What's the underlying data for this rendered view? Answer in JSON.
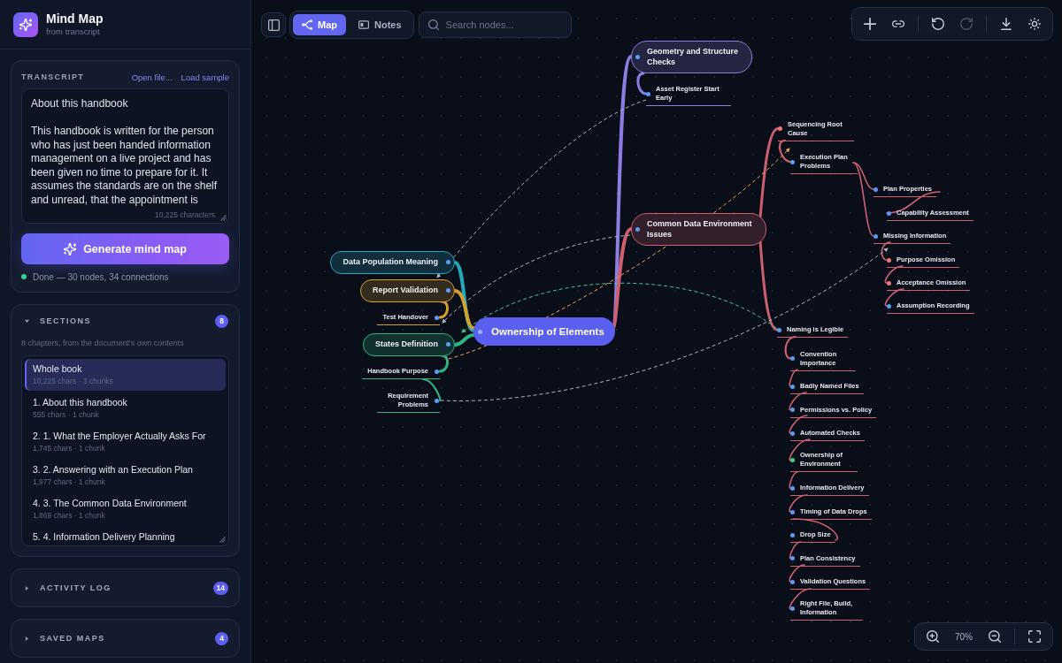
{
  "app": {
    "title": "Mind Map",
    "subtitle": "from transcript"
  },
  "transcript": {
    "label": "TRANSCRIPT",
    "links": [
      {
        "label": "Open file..."
      },
      {
        "label": "Load sample"
      }
    ],
    "value": "About this handbook\n\nThis handbook is written for the person who has just been handed information management on a live project and has been given no time to prepare for it. It assumes the standards are on the shelf and unread, that the appointment is",
    "char_count": "10,225 characters",
    "generate_button": "Generate mind map",
    "status": {
      "text": "Done — 30 nodes, 34 connections",
      "kind": "done"
    }
  },
  "sections": {
    "title": "SECTIONS",
    "count": "8",
    "expanded": true,
    "description": "8 chapters, from the document's own contents",
    "items": [
      {
        "title": "Whole book",
        "meta": "10,225 chars · 3 chunks",
        "selected": true
      },
      {
        "title": "1. About this handbook",
        "meta": "555 chars · 1 chunk",
        "selected": false
      },
      {
        "title": "2. 1. What the Employer Actually Asks For",
        "meta": "1,745 chars · 1 chunk",
        "selected": false
      },
      {
        "title": "3. 2. Answering with an Execution Plan",
        "meta": "1,977 chars · 1 chunk",
        "selected": false
      },
      {
        "title": "4. 3. The Common Data Environment",
        "meta": "1,869 chars · 1 chunk",
        "selected": false
      },
      {
        "title": "5. 4. Information Delivery Planning",
        "selected": false
      }
    ]
  },
  "panels": [
    {
      "title": "ACTIVITY LOG",
      "count": "14",
      "expanded": false
    },
    {
      "title": "SAVED MAPS",
      "count": "4",
      "expanded": false
    }
  ],
  "view_tabs": [
    {
      "label": "Map",
      "kind": "map",
      "selected": true
    },
    {
      "label": "Notes",
      "kind": "notes",
      "selected": false
    }
  ],
  "search": {
    "placeholder": "Search nodes..."
  },
  "actions": [
    [
      {
        "kind": "add",
        "disabled": false
      },
      {
        "kind": "link",
        "disabled": false
      }
    ],
    [
      {
        "kind": "undo",
        "disabled": false
      },
      {
        "kind": "redo",
        "disabled": true
      }
    ],
    [
      {
        "kind": "download",
        "disabled": false
      },
      {
        "kind": "theme",
        "disabled": false
      }
    ]
  ],
  "zoom": {
    "reading": "70%"
  },
  "mind_map": {
    "root": {
      "text": "Ownership of Elements",
      "kind": "root",
      "color": "#8fb0ff",
      "children": [
        {
          "text": "Data Population Meaning",
          "kind": "topic",
          "branch": {
            "color": "#22a9c0"
          },
          "color": "#5b9cf5"
        },
        {
          "text": "Report Validation",
          "kind": "topic",
          "branch": {
            "color": "#d4a22c"
          },
          "color": "#5b9cf5",
          "children": [
            {
              "text": "Test Handover",
              "kind": "subtopic",
              "color": "#5b9cf5"
            }
          ]
        },
        {
          "text": "States Definition",
          "kind": "topic",
          "branch": {
            "color": "#2fb384"
          },
          "color": "#5b9cf5",
          "children": [
            {
              "text": "Handbook Purpose",
              "kind": "subtopic",
              "color": "#5b9cf5",
              "children": [
                {
                  "text": "Requirement Problems",
                  "kind": "subtopic",
                  "color": "#5b9cf5"
                }
              ]
            }
          ]
        },
        {
          "text": "Geometry and Structure Checks",
          "kind": "topic",
          "branch": {
            "color": "#8b7ee0"
          },
          "color": "#5b9cf5",
          "children": [
            {
              "text": "Asset Register Start Early",
              "kind": "subtopic",
              "color": "#5b9cf5"
            }
          ]
        },
        {
          "text": "Common Data Environment Issues",
          "kind": "topic",
          "branch": {
            "color": "#cc5f70"
          },
          "color": "#5b9cf5",
          "children": [
            {
              "text": "Sequencing Root Cause",
              "kind": "subtopic",
              "color": "#f07575",
              "children": [
                {
                  "text": "Execution Plan Problems",
                  "kind": "subtopic",
                  "color": "#5b9cf5",
                  "children": [
                    {
                      "text": "Plan Properties",
                      "kind": "subtopic",
                      "color": "#5b9cf5",
                      "children": [
                        {
                          "text": "Capability Assessment",
                          "kind": "subtopic",
                          "color": "#5b9cf5"
                        }
                      ]
                    },
                    {
                      "text": "Missing Information",
                      "kind": "subtopic",
                      "color": "#5b9cf5",
                      "children": [
                        {
                          "text": "Purpose Omission",
                          "kind": "subtopic",
                          "color": "#f07575",
                          "children": [
                            {
                              "text": "Acceptance Omission",
                              "kind": "subtopic",
                              "color": "#f07575",
                              "children": [
                                {
                                  "text": "Assumption Recording",
                                  "kind": "subtopic",
                                  "color": "#5b9cf5"
                                }
                              ]
                            }
                          ]
                        }
                      ]
                    }
                  ]
                }
              ]
            },
            {
              "text": "Naming is Legible",
              "kind": "subtopic",
              "color": "#5b9cf5",
              "children": [
                {
                  "text": "Convention Importance",
                  "kind": "subtopic",
                  "color": "#5b9cf5",
                  "children": [
                    {
                      "text": "Badly Named Files",
                      "kind": "subtopic",
                      "color": "#5b9cf5",
                      "children": [
                        {
                          "text": "Permissions vs. Policy",
                          "kind": "subtopic",
                          "color": "#5b9cf5",
                          "children": [
                            {
                              "text": "Automated Checks",
                              "kind": "subtopic",
                              "color": "#5b9cf5",
                              "children": [
                                {
                                  "text": "Ownership of Environment",
                                  "kind": "subtopic",
                                  "color": "#3ecf8e",
                                  "children": [
                                    {
                                      "text": "Information Delivery",
                                      "kind": "subtopic",
                                      "color": "#5b9cf5",
                                      "children": [
                                        {
                                          "text": "Timing of Data Drops",
                                          "kind": "subtopic",
                                          "color": "#5b9cf5",
                                          "children": [
                                            {
                                              "text": "Drop Size",
                                              "kind": "subtopic",
                                              "color": "#5b9cf5",
                                              "children": [
                                                {
                                                  "text": "Plan Consistency",
                                                  "kind": "subtopic",
                                                  "color": "#5b9cf5",
                                                  "children": [
                                                    {
                                                      "text": "Validation Questions",
                                                      "kind": "subtopic",
                                                      "color": "#5b9cf5",
                                                      "children": [
                                                        {
                                                          "text": "Right File, Build, Information",
                                                          "kind": "subtopic",
                                                          "color": "#5b9cf5"
                                                        }
                                                      ]
                                                    }
                                                  ]
                                                }
                                              ]
                                            }
                                          ]
                                        }
                                      ]
                                    }
                                  ]
                                }
                              ]
                            }
                          ]
                        }
                      ]
                    }
                  ]
                }
              ]
            }
          ]
        }
      ]
    },
    "cross_links": [
      {
        "color": "#a9b4c8"
      },
      {
        "color": "#a9b4c8"
      },
      {
        "color": "#f0a050"
      },
      {
        "color": "#3cc99a"
      },
      {
        "color": "#a9b4c8"
      }
    ]
  }
}
